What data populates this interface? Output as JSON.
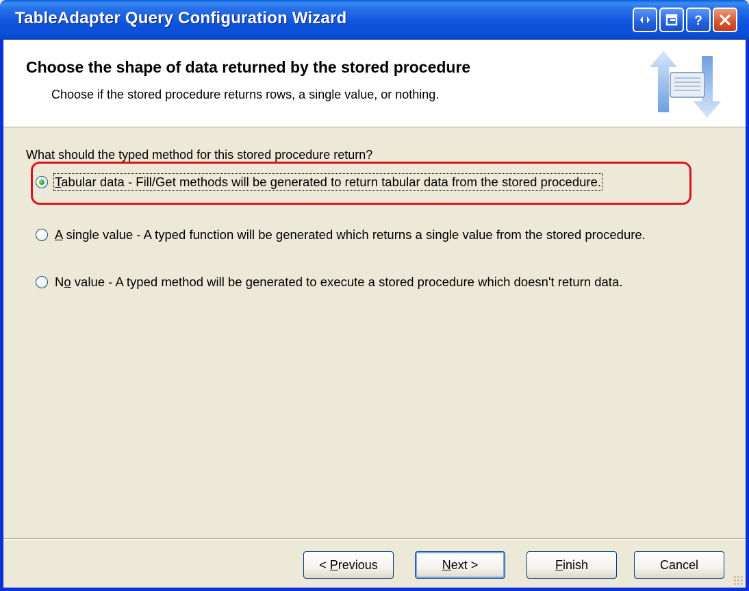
{
  "window": {
    "title": "TableAdapter Query Configuration Wizard",
    "title_buttons": [
      "restore-icon",
      "minimize-icon",
      "help-icon",
      "close-icon"
    ]
  },
  "header": {
    "title": "Choose the shape of data returned by the stored procedure",
    "subtitle": "Choose if the stored procedure returns rows, a single value, or nothing.",
    "icon": "wizard-query-icon"
  },
  "question": "What should the typed method for this stored procedure return?",
  "options": [
    {
      "access_key": "T",
      "rest": "abular data - Fill/Get methods will be generated to return tabular data from the stored procedure.",
      "selected": true
    },
    {
      "access_key": "A",
      "rest": " single value - A typed function will be generated which returns a single value from the stored procedure.",
      "selected": false
    },
    {
      "prefix": "N",
      "access_key": "o",
      "rest": " value - A typed method will be generated to execute a stored procedure which doesn't return data.",
      "selected": false
    }
  ],
  "buttons": {
    "previous_prefix": "< ",
    "previous_key": "P",
    "previous_rest": "revious",
    "next_key": "N",
    "next_rest": "ext >",
    "finish_key": "F",
    "finish_rest": "inish",
    "cancel": "Cancel"
  },
  "colors": {
    "title_bar": "#0b4fd6",
    "highlight": "#e0101b",
    "dialog_bg": "#ece9d8"
  }
}
